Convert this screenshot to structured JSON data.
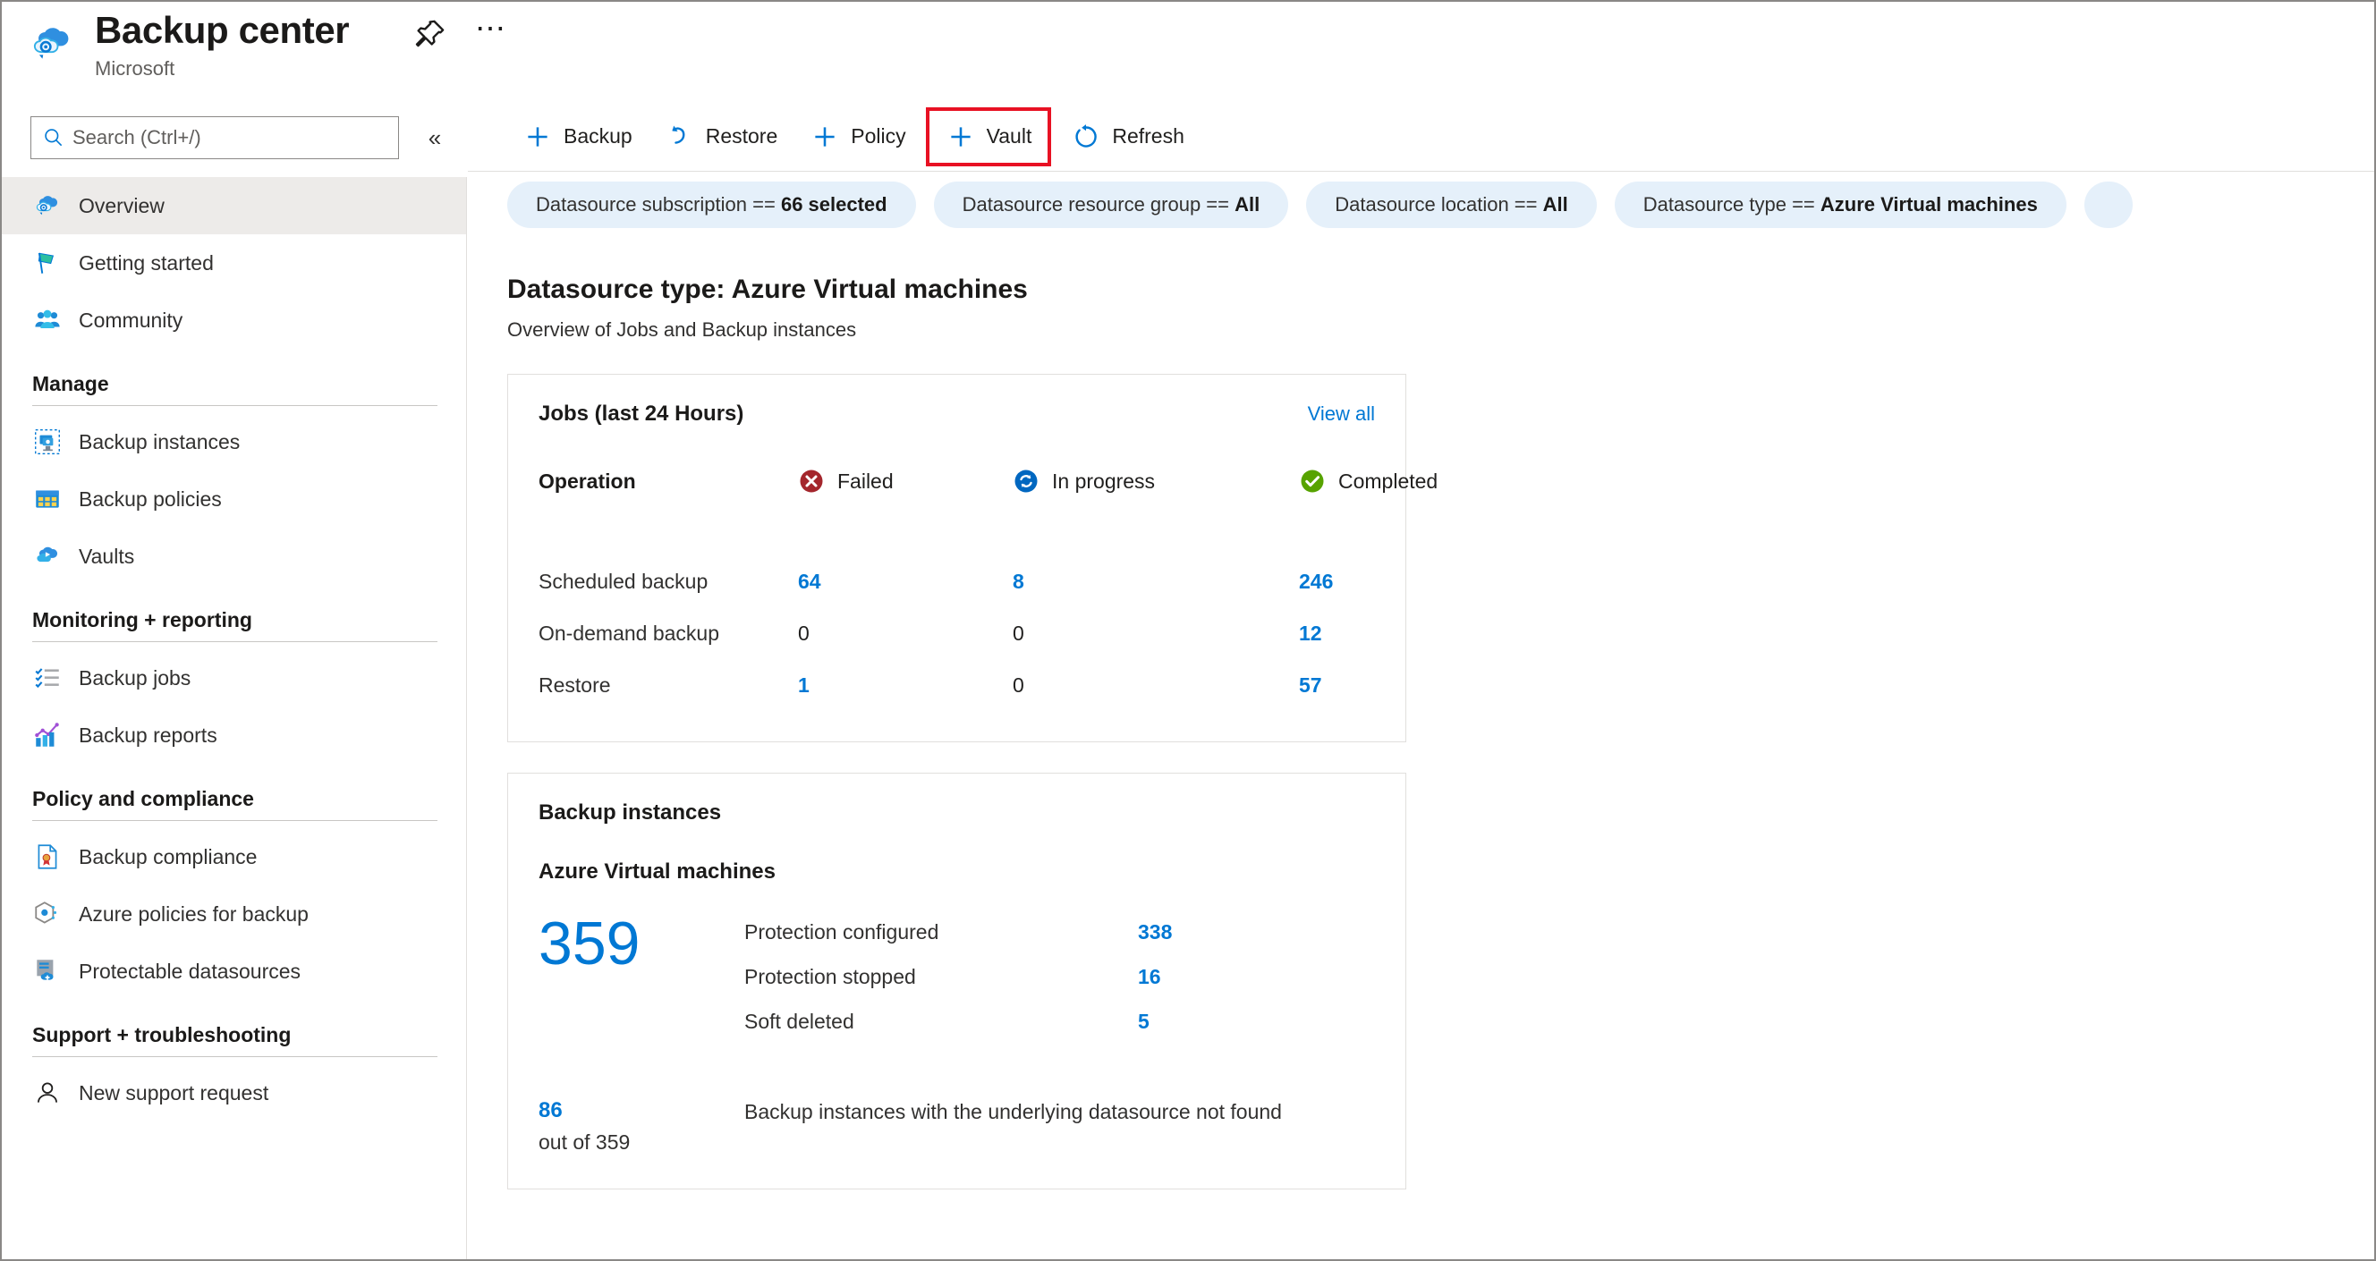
{
  "header": {
    "title": "Backup center",
    "subtitle": "Microsoft",
    "pin_icon": "pin-icon",
    "more_icon": "ellipsis-icon",
    "brand_icon": "backup-center-cloud-icon"
  },
  "search": {
    "placeholder": "Search (Ctrl+/)",
    "value": "",
    "icon": "search-icon",
    "collapse_icon": "chevron-double-left-icon"
  },
  "sidebar": {
    "top_items": [
      {
        "label": "Overview",
        "icon": "backup-center-cloud-icon",
        "selected": true
      },
      {
        "label": "Getting started",
        "icon": "flag-icon",
        "selected": false
      },
      {
        "label": "Community",
        "icon": "people-icon",
        "selected": false
      }
    ],
    "groups": [
      {
        "title": "Manage",
        "items": [
          {
            "label": "Backup instances",
            "icon": "backup-instance-icon"
          },
          {
            "label": "Backup policies",
            "icon": "policy-grid-icon"
          },
          {
            "label": "Vaults",
            "icon": "vault-cloud-icon"
          }
        ]
      },
      {
        "title": "Monitoring + reporting",
        "items": [
          {
            "label": "Backup jobs",
            "icon": "checklist-icon"
          },
          {
            "label": "Backup reports",
            "icon": "bar-chart-icon"
          }
        ]
      },
      {
        "title": "Policy and compliance",
        "items": [
          {
            "label": "Backup compliance",
            "icon": "compliance-document-icon"
          },
          {
            "label": "Azure policies for backup",
            "icon": "azure-policy-hexagon-icon"
          },
          {
            "label": "Protectable datasources",
            "icon": "protectable-datasource-icon"
          }
        ]
      },
      {
        "title": "Support + troubleshooting",
        "items": [
          {
            "label": "New support request",
            "icon": "person-support-icon"
          }
        ]
      }
    ]
  },
  "toolbar": {
    "buttons": [
      {
        "label": "Backup",
        "icon": "plus-icon",
        "highlighted": false
      },
      {
        "label": "Restore",
        "icon": "restore-arrow-icon",
        "highlighted": false
      },
      {
        "label": "Policy",
        "icon": "plus-icon",
        "highlighted": false
      },
      {
        "label": "Vault",
        "icon": "plus-icon",
        "highlighted": true
      },
      {
        "label": "Refresh",
        "icon": "refresh-icon",
        "highlighted": false
      }
    ],
    "highlight_color": "#e81123"
  },
  "filters": [
    {
      "label": "Datasource subscription ==",
      "value": "66 selected"
    },
    {
      "label": "Datasource resource group ==",
      "value": "All"
    },
    {
      "label": "Datasource location ==",
      "value": "All"
    },
    {
      "label": "Datasource type ==",
      "value": "Azure Virtual machines"
    }
  ],
  "panel": {
    "title": "Datasource type: Azure Virtual machines",
    "subtitle": "Overview of Jobs and Backup instances"
  },
  "jobs_card": {
    "title": "Jobs (last 24 Hours)",
    "view_all": "View all",
    "operation_header": "Operation",
    "status_columns": [
      {
        "label": "Failed",
        "icon": "error-circle-icon",
        "color": "#a4262c"
      },
      {
        "label": "In progress",
        "icon": "in-progress-circle-icon",
        "color": "#0078d4"
      },
      {
        "label": "Completed",
        "icon": "success-circle-icon",
        "color": "#57a300"
      }
    ],
    "rows": [
      {
        "operation": "Scheduled backup",
        "failed": "64",
        "in_progress": "8",
        "completed": "246"
      },
      {
        "operation": "On-demand backup",
        "failed": "0",
        "in_progress": "0",
        "completed": "12"
      },
      {
        "operation": "Restore",
        "failed": "1",
        "in_progress": "0",
        "completed": "57"
      }
    ]
  },
  "instances_card": {
    "title": "Backup instances",
    "subtitle": "Azure Virtual machines",
    "total": "359",
    "rows": [
      {
        "label": "Protection configured",
        "value": "338"
      },
      {
        "label": "Protection stopped",
        "value": "16"
      },
      {
        "label": "Soft deleted",
        "value": "5"
      }
    ],
    "footer_count": "86",
    "footer_outof": "out of 359",
    "footer_text": "Backup instances with the underlying datasource not found"
  },
  "colors": {
    "accent": "#0078d4",
    "pill_bg": "#e5f0fa",
    "selected_bg": "#edebe9",
    "text": "#323130"
  }
}
